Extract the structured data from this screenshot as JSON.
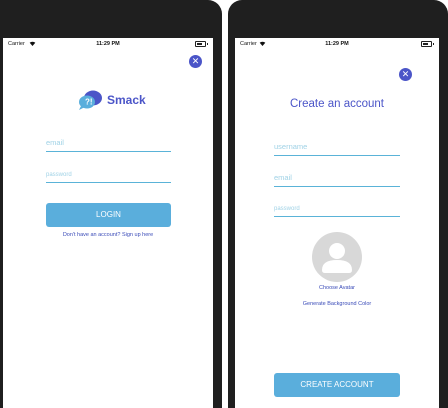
{
  "status_bar": {
    "carrier": "Carrier",
    "time": "11:29 PM"
  },
  "login_screen": {
    "close_icon": "close-icon",
    "app_name": "Smack",
    "logo_icon": "chat-bubbles-icon",
    "email_placeholder": "email",
    "password_placeholder": "password",
    "login_button": "LOGIN",
    "signup_link": "Don't have an account? Sign up here"
  },
  "create_account_screen": {
    "close_icon": "close-icon",
    "title": "Create an account",
    "username_placeholder": "username",
    "email_placeholder": "email",
    "password_placeholder": "password",
    "avatar_icon": "user-avatar-icon",
    "choose_avatar_link": "Choose Avatar",
    "generate_bg_link": "Generate Background Color",
    "create_button": "CREATE ACCOUNT"
  },
  "colors": {
    "accent": "#4b55c8",
    "button": "#5aaedc",
    "field_underline": "#5ab3d8",
    "placeholder": "#a0d2e6",
    "device_frame": "#1f1f1f",
    "avatar_bg": "#d8d8d8"
  }
}
